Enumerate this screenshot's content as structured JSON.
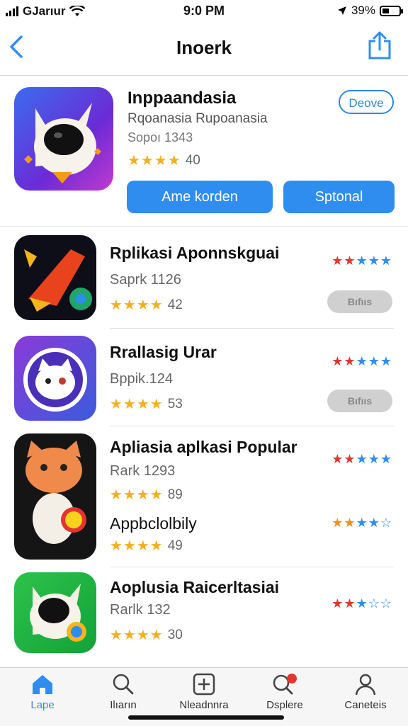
{
  "status_bar": {
    "carrier": "GJarıur",
    "time": "9:0 PM",
    "battery": "39%"
  },
  "nav": {
    "title": "Inoerk"
  },
  "featured": {
    "name": "Inppaandasia",
    "subtitle": "Rqoanasia Rupoanasia",
    "meta": "Sopoı 1343",
    "stars": "★★★★",
    "rating_count": "40",
    "device_pill": "Deove",
    "button_primary": "Ame korden",
    "button_secondary": "Sptonal"
  },
  "apps": [
    {
      "name": "Rplikasi Aponnskguai",
      "sub": "Saprk 1126",
      "stars": "★★★★",
      "count": "42",
      "pill": "Bıfııs"
    },
    {
      "name": "Rrallasig Urar",
      "sub": "Bppik.124",
      "stars": "★★★★",
      "count": "53",
      "pill": "Bıfııs"
    },
    {
      "name": "Apliasia aplkasi Popular",
      "sub": "Rark 1293",
      "stars": "★★★★",
      "count": "89"
    },
    {
      "name": "Appbclolbily",
      "stars": "★★★★",
      "count": "49"
    },
    {
      "name": "Aoplusia Raicerltasiai",
      "sub": "Rarlk 132",
      "stars": "★★★★",
      "count": "30"
    }
  ],
  "tabs": [
    {
      "label": "Lape",
      "icon": "home-icon"
    },
    {
      "label": "Ilıarın",
      "icon": "search-icon"
    },
    {
      "label": "Nleadnnra",
      "icon": "plus-box-icon"
    },
    {
      "label": "Dsplere",
      "icon": "search-notification-icon"
    },
    {
      "label": "Caneteis",
      "icon": "profile-icon"
    }
  ],
  "colors": {
    "accent": "#2f8df0",
    "star": "#f2b01e",
    "star_red": "#e3342f"
  }
}
